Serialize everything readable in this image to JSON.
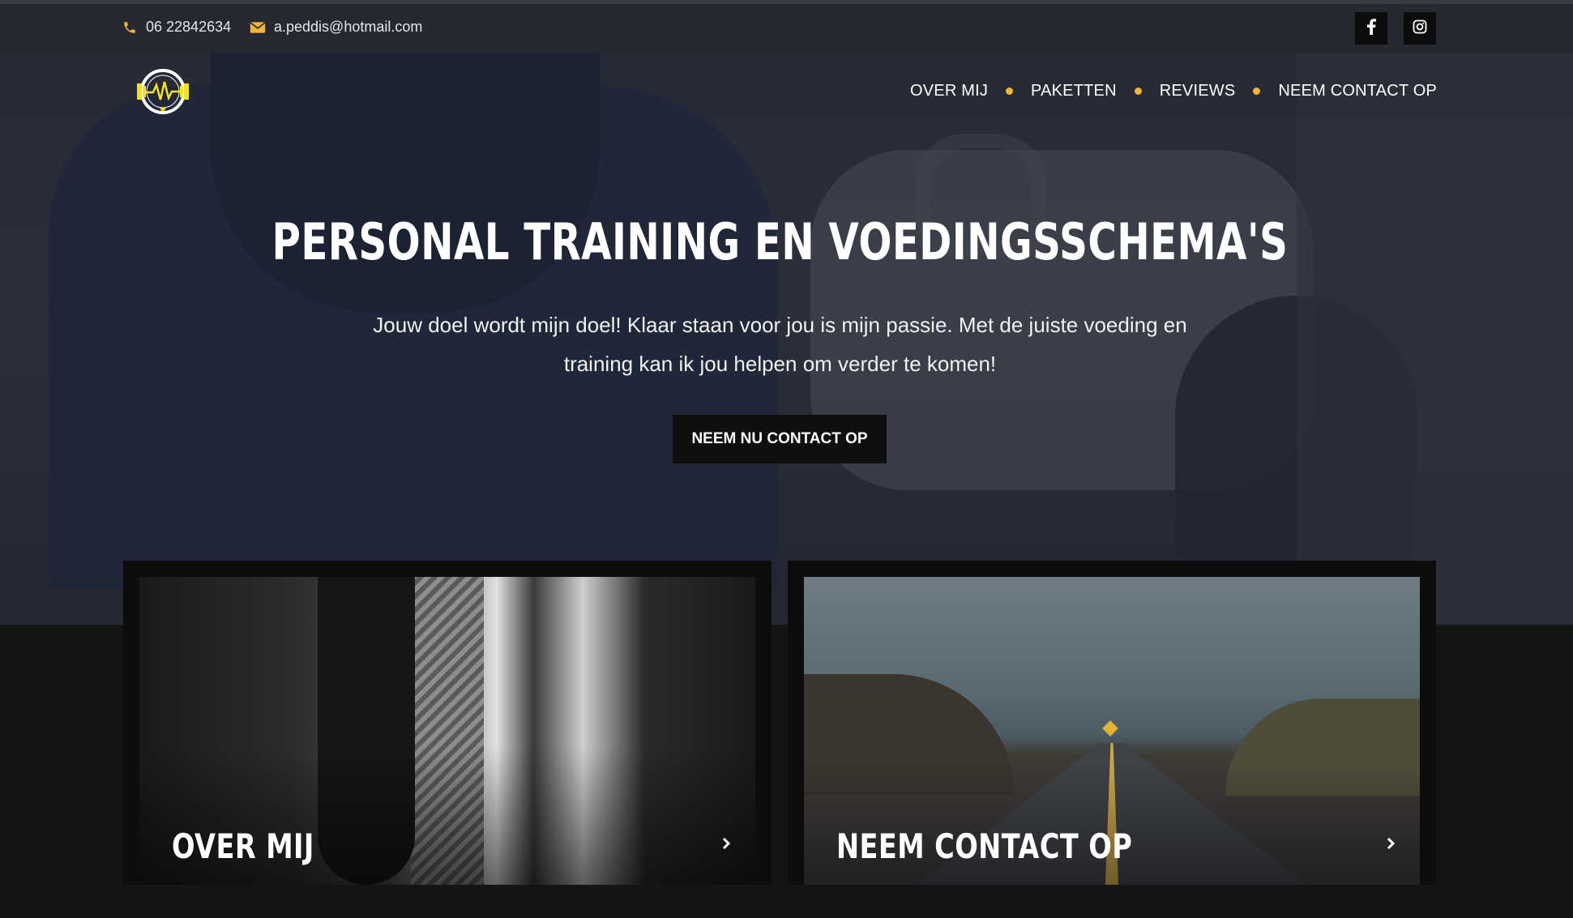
{
  "topbar": {
    "phone": "06 22842634",
    "email": "a.peddis@hotmail.com",
    "phone_icon": "phone-icon",
    "email_icon": "envelope-icon",
    "social": [
      "facebook-icon",
      "instagram-icon"
    ]
  },
  "nav": {
    "items": [
      "OVER MIJ",
      "PAKETTEN",
      "REVIEWS",
      "NEEM CONTACT OP"
    ]
  },
  "hero": {
    "title": "PERSONAL TRAINING EN VOEDINGSSCHEMA'S",
    "subtitle": "Jouw doel wordt mijn doel! Klaar staan voor jou is mijn passie. Met de juiste voeding en training kan ik jou helpen om verder te komen!",
    "cta": "NEEM NU CONTACT OP"
  },
  "cards": [
    {
      "title": "OVER MIJ",
      "arrow_icon": "chevron-right-icon"
    },
    {
      "title": "NEEM CONTACT OP",
      "arrow_icon": "chevron-right-icon"
    }
  ],
  "colors": {
    "accent": "#f2b43a",
    "topbar": "#262932",
    "dark": "#131416",
    "logo_yellow": "#f5e12a"
  }
}
